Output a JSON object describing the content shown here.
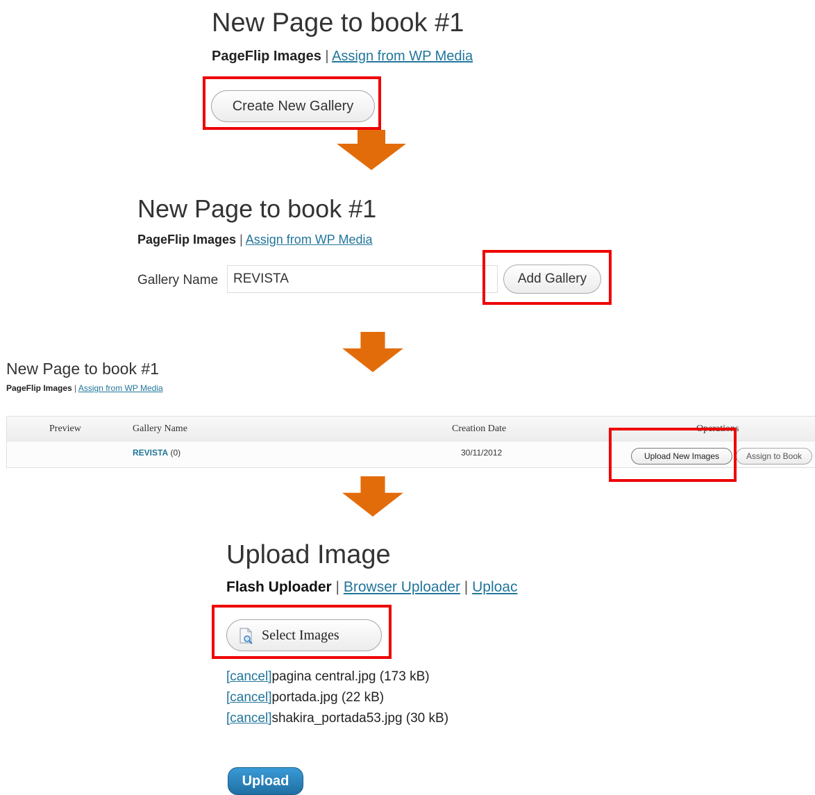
{
  "step1": {
    "title": "New Page to book #1",
    "tab_active": "PageFlip Images",
    "separator": "|",
    "tab_link": "Assign from WP Media",
    "create_button": "Create New Gallery"
  },
  "step2": {
    "title": "New Page to book #1",
    "tab_active": "PageFlip Images",
    "separator": "|",
    "tab_link": "Assign from WP Media",
    "gallery_name_label": "Gallery Name",
    "gallery_name_value": "REVISTA",
    "add_button": "Add Gallery"
  },
  "step3": {
    "title": "New Page to book #1",
    "tab_active": "PageFlip Images",
    "separator": "|",
    "tab_link": "Assign from WP Media",
    "table": {
      "headers": {
        "preview": "Preview",
        "gallery_name": "Gallery Name",
        "creation_date": "Creation Date",
        "operations": "Operations"
      },
      "row": {
        "gallery_name": "REVISTA",
        "count": "(0)",
        "creation_date": "30/11/2012",
        "upload_button": "Upload New Images",
        "assign_button": "Assign to Book"
      }
    }
  },
  "step4": {
    "title": "Upload Image",
    "tab_active": "Flash Uploader",
    "separator": "|",
    "tab_link_1": "Browser Uploader",
    "separator_2": "|",
    "tab_link_2": "Uploac",
    "select_button": "Select Images",
    "cancel_label": "[cancel]",
    "files": [
      "pagina central.jpg (173 kB)",
      "portada.jpg (22 kB)",
      "shakira_portada53.jpg (30 kB)"
    ],
    "upload_button": "Upload"
  },
  "colors": {
    "highlight": "#ee0000",
    "arrow": "#e36c0a",
    "link": "#21759b",
    "primary_button": "#2a8bc4"
  },
  "icons": {
    "select_images": "document-search-icon",
    "step_arrow": "arrow-down-icon"
  }
}
